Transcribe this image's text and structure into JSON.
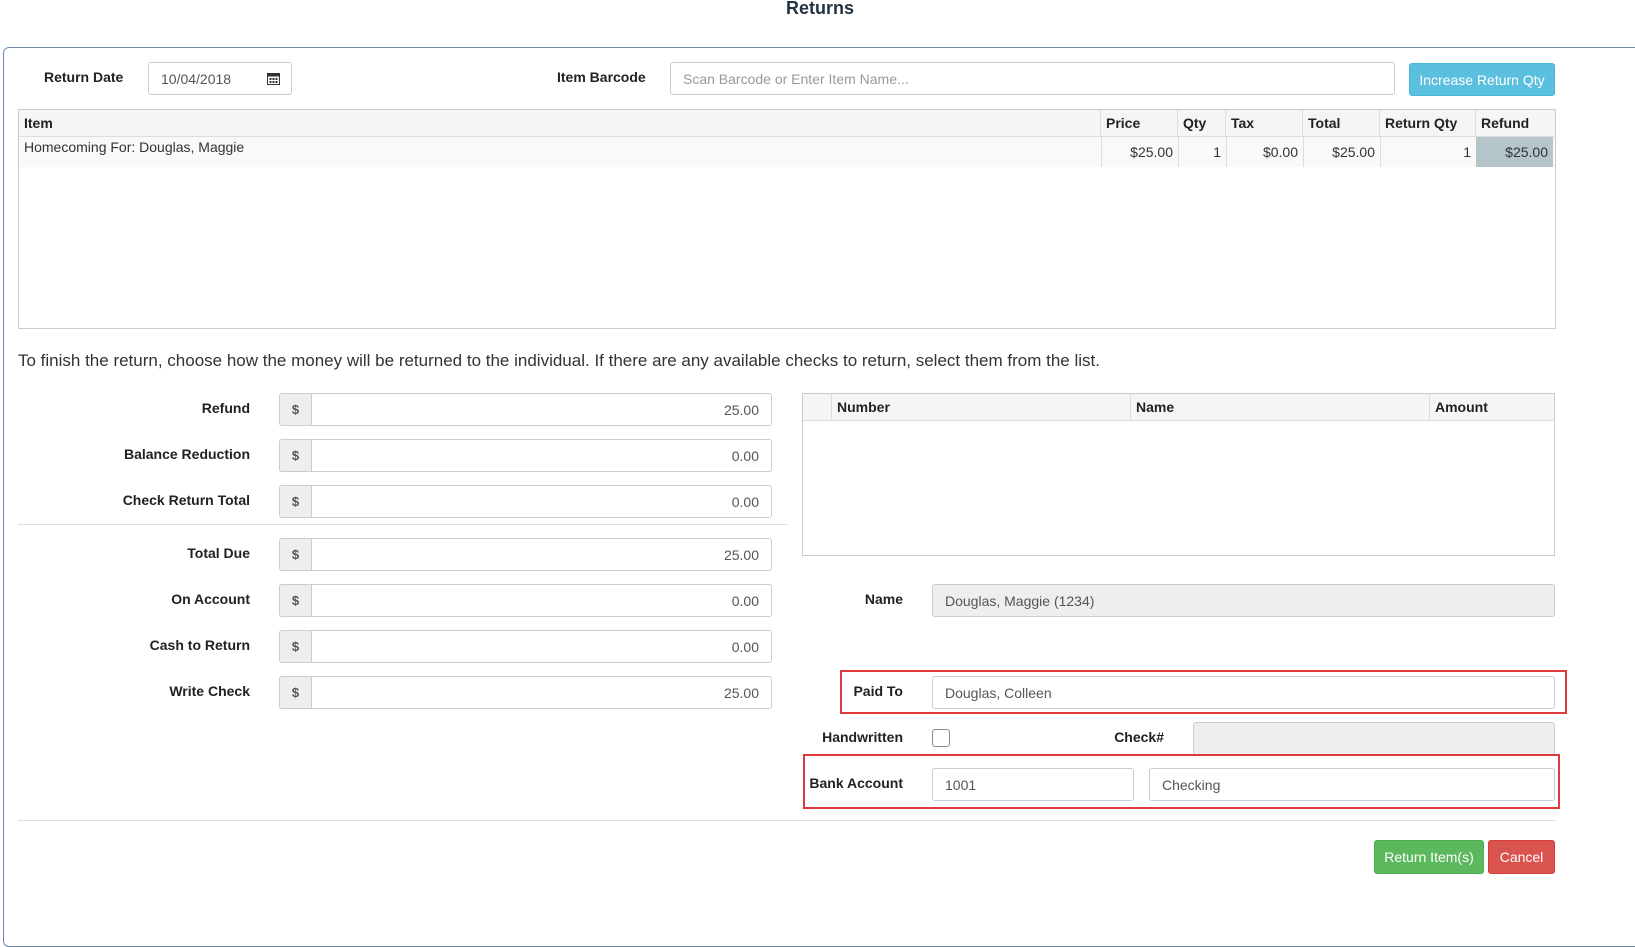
{
  "page": {
    "title": "Returns"
  },
  "header": {
    "return_date_label": "Return Date",
    "return_date_value": "10/04/2018",
    "item_barcode_label": "Item Barcode",
    "barcode_placeholder": "Scan Barcode or Enter Item Name...",
    "increase_button": "Increase Return Qty"
  },
  "items_grid": {
    "columns": [
      "Item",
      "Price",
      "Qty",
      "Tax",
      "Total",
      "Return Qty",
      "Refund"
    ],
    "rows": [
      {
        "item": "Homecoming For: Douglas, Maggie",
        "price": "$25.00",
        "qty": "1",
        "tax": "$0.00",
        "total": "$25.00",
        "return_qty": "1",
        "refund": "$25.00"
      }
    ]
  },
  "instructions": "To finish the return, choose how the money will be returned to the individual. If there are any available checks to return, select them from the list.",
  "currency_symbol": "$",
  "amounts": {
    "refund": {
      "label": "Refund",
      "value": "25.00"
    },
    "balance_reduction": {
      "label": "Balance Reduction",
      "value": "0.00"
    },
    "check_return_total": {
      "label": "Check Return Total",
      "value": "0.00"
    },
    "total_due": {
      "label": "Total Due",
      "value": "25.00"
    },
    "on_account": {
      "label": "On Account",
      "value": "0.00"
    },
    "cash_to_return": {
      "label": "Cash to Return",
      "value": "0.00"
    },
    "write_check": {
      "label": "Write Check",
      "value": "25.00"
    }
  },
  "checks_grid": {
    "columns": [
      "Number",
      "Name",
      "Amount"
    ]
  },
  "payee": {
    "name_label": "Name",
    "name_value": "Douglas, Maggie (1234)",
    "paid_to_label": "Paid To",
    "paid_to_value": "Douglas, Colleen",
    "handwritten_label": "Handwritten",
    "check_number_label": "Check#",
    "bank_account_label": "Bank Account",
    "bank_account_number": "1001",
    "bank_account_name": "Checking"
  },
  "footer": {
    "return_button": "Return Item(s)",
    "cancel_button": "Cancel"
  },
  "colors": {
    "info": "#5bc0de",
    "success": "#5cb85c",
    "danger": "#d9534f",
    "highlight": "#e03a3a",
    "refund_cell": "#b4c6c9"
  }
}
